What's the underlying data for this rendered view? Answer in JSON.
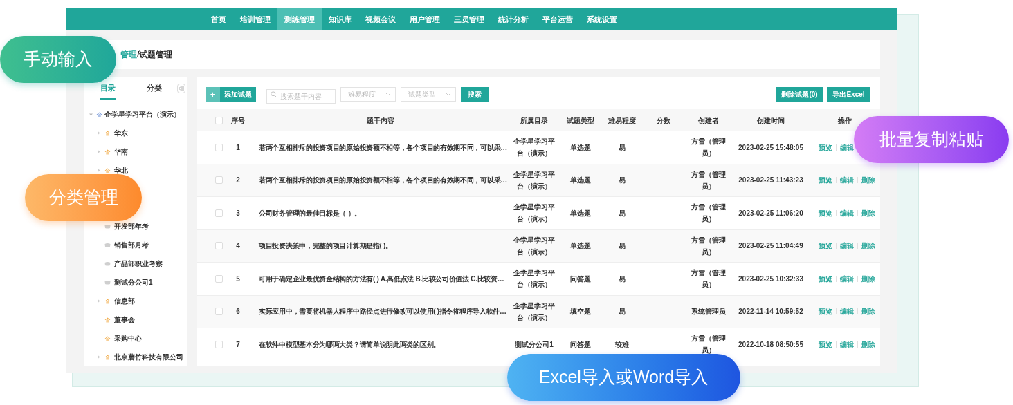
{
  "nav": [
    {
      "label": "首页",
      "selected": false
    },
    {
      "label": "培训管理",
      "selected": false
    },
    {
      "label": "测练管理",
      "selected": true
    },
    {
      "label": "知识库",
      "selected": false
    },
    {
      "label": "视频会议",
      "selected": false
    },
    {
      "label": "用户管理",
      "selected": false
    },
    {
      "label": "三员管理",
      "selected": false
    },
    {
      "label": "统计分析",
      "selected": false
    },
    {
      "label": "平台运营",
      "selected": false
    },
    {
      "label": "系统设置",
      "selected": false
    }
  ],
  "breadcrumb": {
    "parent": "管理",
    "current": "/试题管理"
  },
  "sidebar": {
    "tabs": [
      {
        "label": "目录",
        "selected": true
      },
      {
        "label": "分类",
        "selected": false
      }
    ],
    "tree": [
      {
        "label": "企学星学习平台（演示）",
        "kind": "platform",
        "expanded": true,
        "children": [
          {
            "label": "华东",
            "kind": "org",
            "expanded": false
          },
          {
            "label": "华南",
            "kind": "org",
            "expanded": false
          },
          {
            "label": "华北",
            "kind": "org",
            "expanded": false
          },
          {
            "label": "开发部年考",
            "kind": "exam"
          },
          {
            "label": "销售部月考",
            "kind": "exam"
          },
          {
            "label": "产品部职业考察",
            "kind": "exam"
          },
          {
            "label": "测试分公司1",
            "kind": "exam"
          },
          {
            "label": "信息部",
            "kind": "org",
            "expanded": false
          },
          {
            "label": "董事会",
            "kind": "org"
          },
          {
            "label": "采购中心",
            "kind": "org"
          },
          {
            "label": "北京蘑竹科技有限公司",
            "kind": "org",
            "expanded": false
          }
        ]
      }
    ]
  },
  "toolbar": {
    "add_button": {
      "icon": "+",
      "label": "添加试题"
    },
    "search": {
      "placeholder": "搜索题干内容"
    },
    "filters": [
      {
        "placeholder": "难易程度"
      },
      {
        "placeholder": "试题类型"
      }
    ],
    "search_button": "搜索",
    "delete_button": "删除试题(0)",
    "export_button": "导出Excel"
  },
  "table": {
    "select_all": {
      "checked": false
    },
    "columns": [
      "序号",
      "题干内容",
      "所属目录",
      "试题类型",
      "难易程度",
      "分数",
      "创建者",
      "创建时间",
      "操作"
    ],
    "rows": [
      {
        "checked": false,
        "no": "1",
        "question": "若两个互相排斥的投资项目的原始投资额不相等，各个项目的有效期不同，可以采…",
        "directory": "企学星学习平台（演示）",
        "type": "单选题",
        "difficulty": "易",
        "creator": "方雪（管理员）",
        "created": "2023-02-25 15:48:05",
        "actions": [
          "预览",
          "编辑"
        ]
      },
      {
        "checked": false,
        "no": "2",
        "question": "若两个互相排斥的投资项目的原始投资额不相等，各个项目的有效期不同，可以采…",
        "directory": "企学星学习平台（演示）",
        "type": "单选题",
        "difficulty": "易",
        "creator": "方雪（管理员）",
        "created": "2023-02-25 11:43:23",
        "actions": [
          "预览",
          "编辑",
          "删除"
        ]
      },
      {
        "checked": false,
        "no": "3",
        "question": "公司财务管理的最佳目标是（ ）。",
        "directory": "企学星学习平台（演示）",
        "type": "单选题",
        "difficulty": "易",
        "creator": "方雪（管理员）",
        "created": "2023-02-25 11:06:20",
        "actions": [
          "预览",
          "编辑",
          "删除"
        ]
      },
      {
        "checked": false,
        "no": "4",
        "question": "项目投资决策中，完整的项目计算期是指(  )。",
        "directory": "企学星学习平台（演示）",
        "type": "单选题",
        "difficulty": "易",
        "creator": "方雪（管理员）",
        "created": "2023-02-25 11:04:49",
        "actions": [
          "预览",
          "编辑",
          "删除"
        ]
      },
      {
        "checked": false,
        "no": "5",
        "question": "可用于确定企业最优资金结构的方法有( ) A.高低点法 B.比较公司价值法 C.比较资…",
        "directory": "企学星学习平台（演示）",
        "type": "问答题",
        "difficulty": "易",
        "creator": "方雪（管理员）",
        "created": "2023-02-25 10:32:33",
        "actions": [
          "预览",
          "编辑",
          "删除"
        ]
      },
      {
        "checked": false,
        "no": "6",
        "question": "实际应用中，需要将机器人程序中路径点进行修改可以使用( )指令将程序导入软件…",
        "directory": "企学星学习平台（演示）",
        "type": "填空题",
        "difficulty": "易",
        "creator": "系统管理员",
        "created": "2022-11-14 10:59:52",
        "actions": [
          "预览",
          "编辑",
          "删除"
        ]
      },
      {
        "checked": false,
        "no": "7",
        "question": "在软件中模型基本分为哪两大类？请简单说明此两类的区别。",
        "directory": "测试分公司1",
        "type": "问答题",
        "difficulty": "较难",
        "creator": "方雪（管理员）",
        "created": "2022-10-18 08:50:55",
        "actions": [
          "预览",
          "编辑",
          "删除"
        ]
      }
    ]
  },
  "callouts": [
    {
      "text": "手动输入",
      "kind": "green"
    },
    {
      "text": "分类管理",
      "kind": "orange"
    },
    {
      "text": "批量复制粘贴",
      "kind": "purple"
    },
    {
      "text": "Excel导入或Word导入",
      "kind": "blue"
    }
  ]
}
